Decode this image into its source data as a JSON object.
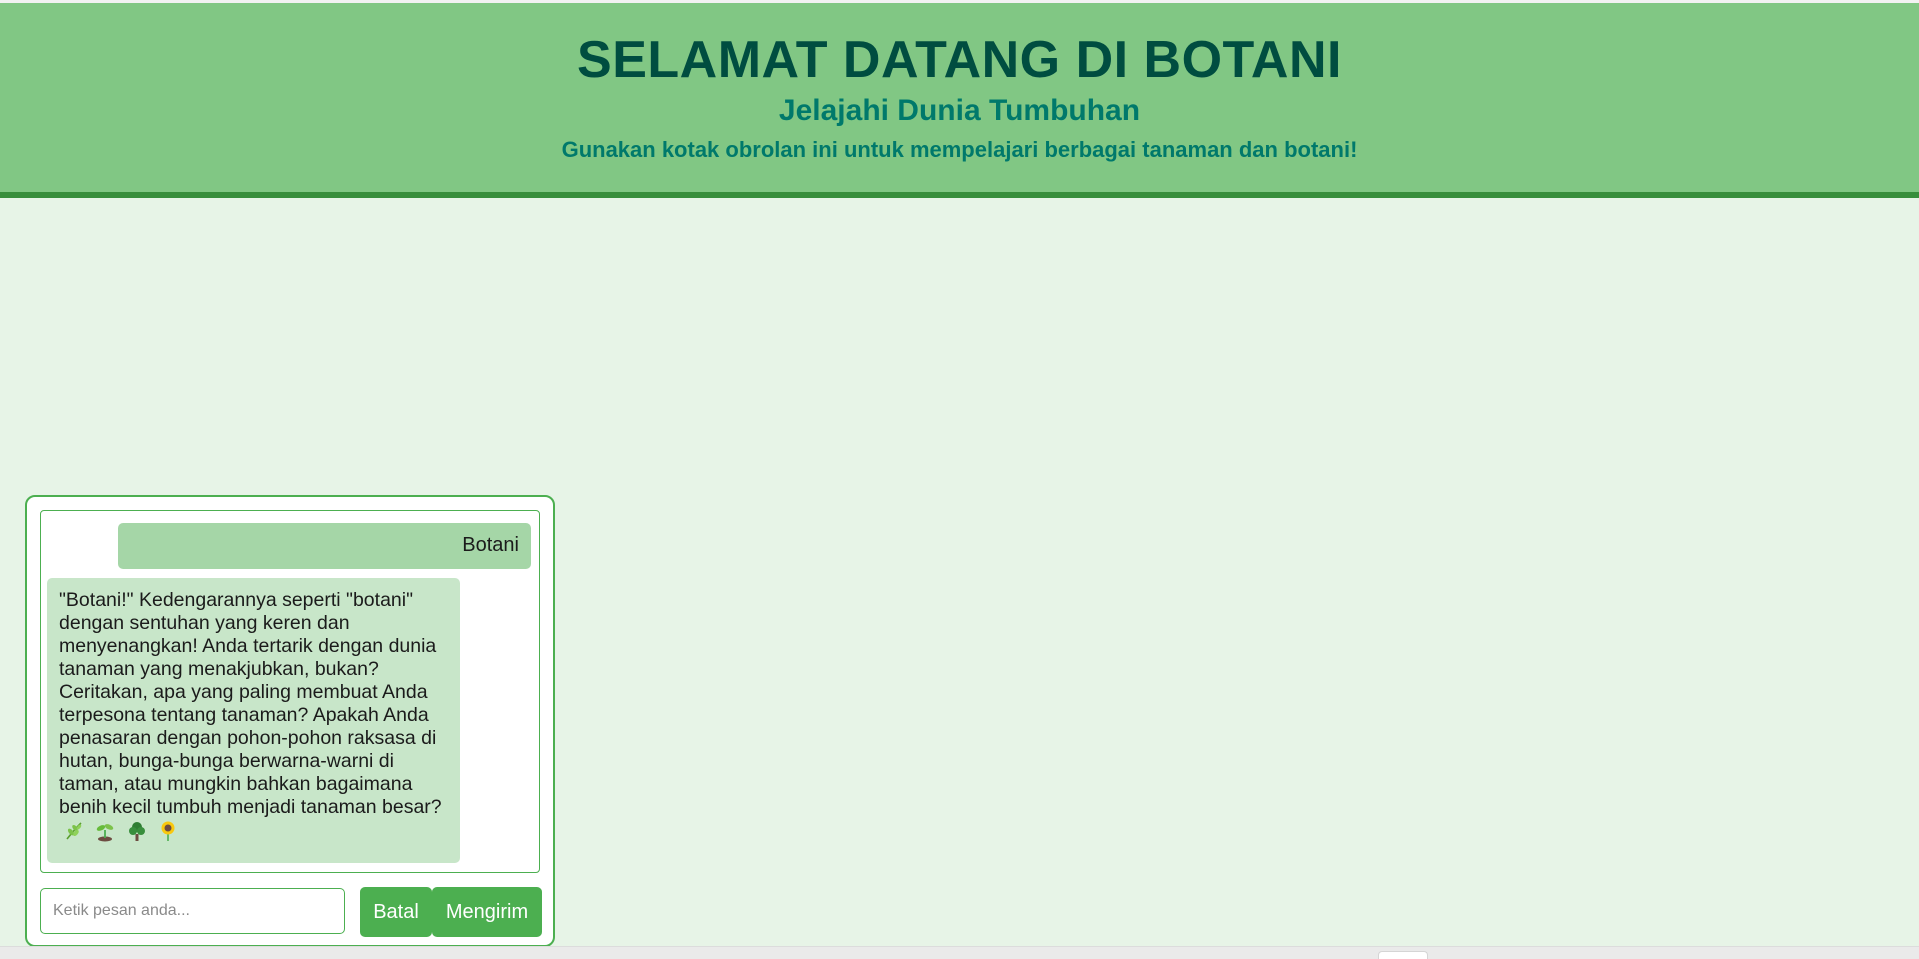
{
  "header": {
    "title": "SELAMAT DATANG DI BOTANI",
    "subtitle": "Jelajahi Dunia Tumbuhan",
    "tagline": "Gunakan kotak obrolan ini untuk mempelajari berbagai tanaman dan botani!"
  },
  "chat": {
    "messages": [
      {
        "role": "user",
        "text": "Botani"
      },
      {
        "role": "bot",
        "text": "\"Botani!\" Kedengarannya seperti \"botani\" dengan sentuhan yang keren dan menyenangkan! Anda tertarik dengan dunia tanaman yang menakjubkan, bukan? Ceritakan, apa yang paling membuat Anda terpesona tentang tanaman? Apakah Anda penasaran dengan pohon-pohon raksasa di hutan, bunga-bunga berwarna-warni di taman, atau mungkin bahkan bagaimana benih kecil tumbuh menjadi tanaman besar?",
        "emojis": [
          "herb-icon",
          "seedling-icon",
          "tree-icon",
          "sunflower-icon"
        ]
      }
    ],
    "input": {
      "value": "",
      "placeholder": "Ketik pesan anda..."
    },
    "buttons": {
      "cancel_label": "Batal",
      "send_label": "Mengirim"
    }
  },
  "colors": {
    "page_background": "#e7f4e7",
    "header_background": "#81c784",
    "header_border": "#388e3c",
    "title_color": "#004d40",
    "subtitle_color": "#00796b",
    "user_bubble": "#a5d6a7",
    "bot_bubble": "#c8e6c9",
    "button": "#4caf50"
  }
}
